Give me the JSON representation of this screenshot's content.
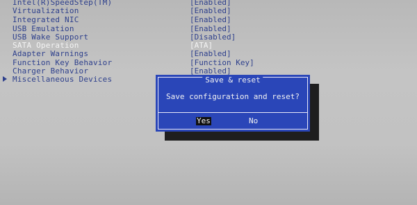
{
  "settings": [
    {
      "label": "Intel(R)SpeedStep(TM)",
      "value": "[Enabled]"
    },
    {
      "label": "Virtualization",
      "value": "[Enabled]"
    },
    {
      "label": "Integrated NIC",
      "value": "[Enabled]"
    },
    {
      "label": "USB Emulation",
      "value": "[Enabled]"
    },
    {
      "label": "USB Wake Support",
      "value": "[Disabled]"
    },
    {
      "label": "SATA Operation",
      "value": "[ATA]"
    },
    {
      "label": "Adapter Warnings",
      "value": "[Enabled]"
    },
    {
      "label": "Function Key Behavior",
      "value": "[Function Key]"
    },
    {
      "label": "Charger Behavior",
      "value": "[Enabled]"
    },
    {
      "label": "Miscellaneous Devices",
      "value": ""
    }
  ],
  "dialog": {
    "title": "Save & reset",
    "message": "Save configuration and reset?",
    "yes_label": "Yes",
    "no_label": "No"
  },
  "colors": {
    "background": "#bdbdbd",
    "text": "#2d3f8c",
    "selected_text": "#f4f4f4",
    "dialog_bg": "#2a46b8",
    "dialog_text": "#f2f2f2",
    "shadow": "#1e1e1e"
  }
}
